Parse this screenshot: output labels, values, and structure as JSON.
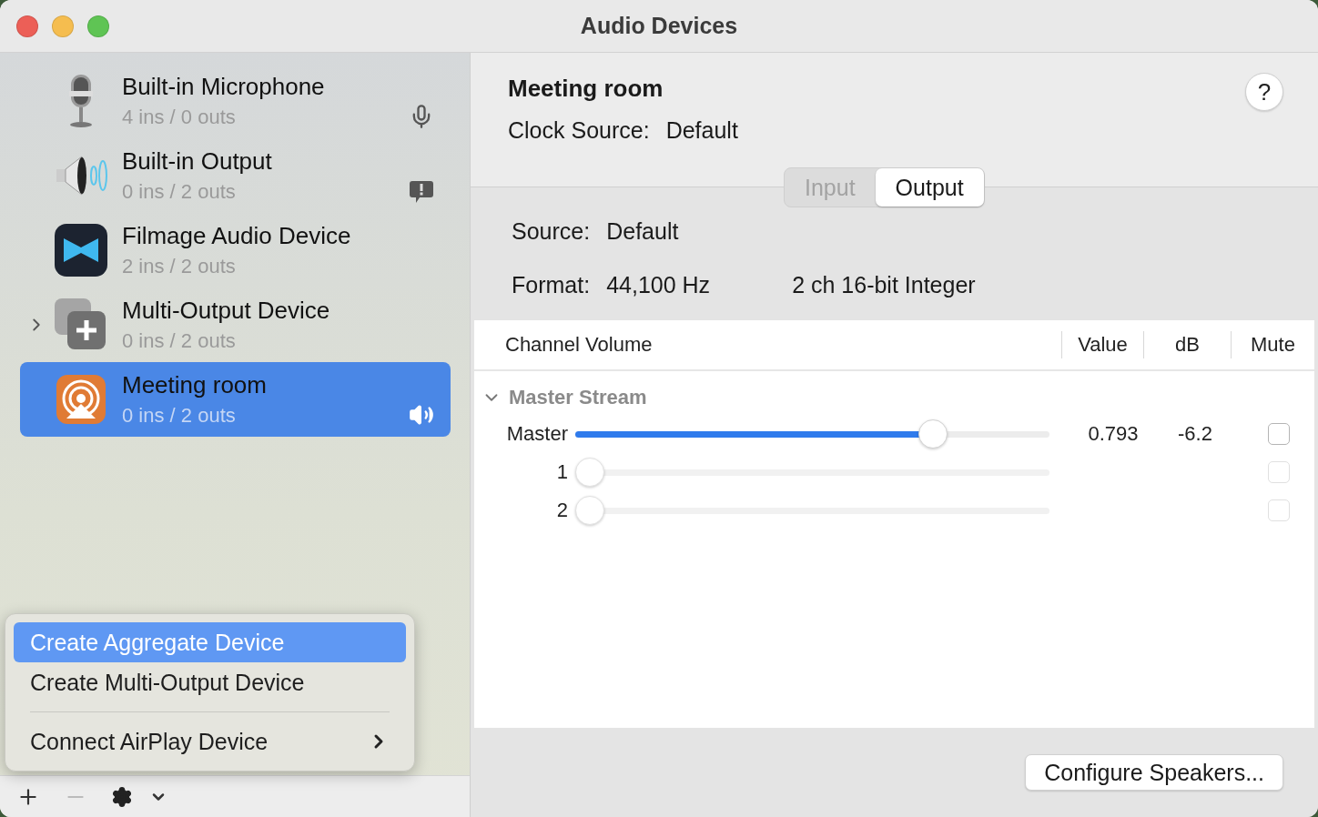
{
  "window": {
    "title": "Audio Devices"
  },
  "devices": [
    {
      "name": "Built-in Microphone",
      "io": "4 ins / 0 outs",
      "kind": "microphone",
      "indicator": {
        "kind": "microphone"
      },
      "expandable": false,
      "selected": false
    },
    {
      "name": "Built-in Output",
      "io": "0 ins / 2 outs",
      "kind": "speaker",
      "indicator": {
        "kind": "alert"
      },
      "expandable": false,
      "selected": false
    },
    {
      "name": "Filmage Audio Device",
      "io": "2 ins / 2 outs",
      "kind": "filmage",
      "expandable": false,
      "selected": false
    },
    {
      "name": "Multi-Output Device",
      "io": "0 ins / 2 outs",
      "kind": "multi",
      "expandable": true,
      "selected": false
    },
    {
      "name": "Meeting room",
      "io": "0 ins / 2 outs",
      "kind": "airplay",
      "indicator": {
        "kind": "speaker"
      },
      "expandable": false,
      "selected": true
    }
  ],
  "menu": [
    {
      "label": "Create Aggregate Device",
      "selected": true,
      "submenu": false,
      "separator_before": false
    },
    {
      "label": "Create Multi-Output Device",
      "selected": false,
      "submenu": false,
      "separator_before": false
    },
    {
      "label": "Connect AirPlay Device",
      "selected": false,
      "submenu": true,
      "separator_before": true
    }
  ],
  "toolbar": {
    "remove_disabled": true
  },
  "detail": {
    "title": "Meeting room",
    "clock_label": "Clock Source:",
    "clock_value": "Default",
    "help": "?",
    "tabs": [
      {
        "label": "Input",
        "selected": false
      },
      {
        "label": "Output",
        "selected": true
      }
    ],
    "source_label": "Source:",
    "source_value": "Default",
    "format_label": "Format:",
    "format_rate": "44,100 Hz",
    "format_bits": "2 ch 16-bit Integer",
    "columns": [
      "Channel Volume",
      "Value",
      "dB",
      "Mute"
    ],
    "group": {
      "name": "Master Stream",
      "expanded": true,
      "channels": [
        {
          "name": "Master",
          "level": 0.77,
          "value": "0.793",
          "db": "-6.2",
          "muted": false,
          "disabled": false
        },
        {
          "name": "1",
          "level": 0,
          "muted": false,
          "disabled": true
        },
        {
          "name": "2",
          "level": 0,
          "muted": false,
          "disabled": true
        }
      ]
    },
    "button": "Configure Speakers..."
  }
}
